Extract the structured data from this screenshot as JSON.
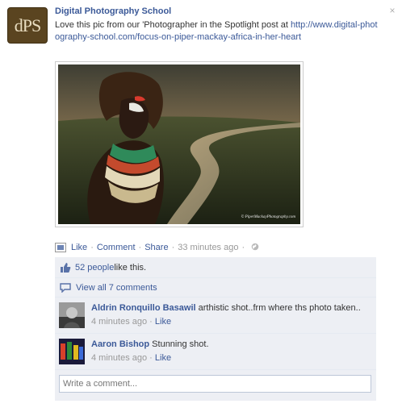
{
  "post": {
    "author": "Digital Photography School",
    "avatar_text": "dPS",
    "text_prefix": "Love this pic from our 'Photographer in the Spotlight post at ",
    "text_link": "http://www.digital-photography-school.com/focus-on-piper-mackay-africa-in-her-heart",
    "photo_credit": "© PiperMackayPhotography.com"
  },
  "actions": {
    "like": "Like",
    "comment": "Comment",
    "share": "Share",
    "time": "33 minutes ago"
  },
  "feedback": {
    "likes_count": "52 people",
    "likes_suffix": " like this.",
    "view_all": "View all 7 comments",
    "comments": [
      {
        "author": "Aldrin Ronquillo Basawil",
        "text": " arthistic shot..frm where ths photo taken..",
        "time": "4 minutes ago",
        "like": "Like"
      },
      {
        "author": "Aaron Bishop",
        "text": " Stunning shot.",
        "time": "4 minutes ago",
        "like": "Like"
      }
    ],
    "write_placeholder": "Write a comment..."
  },
  "colors": {
    "link": "#3b5998",
    "meta": "#999999",
    "feedback_bg": "#edeff4"
  }
}
